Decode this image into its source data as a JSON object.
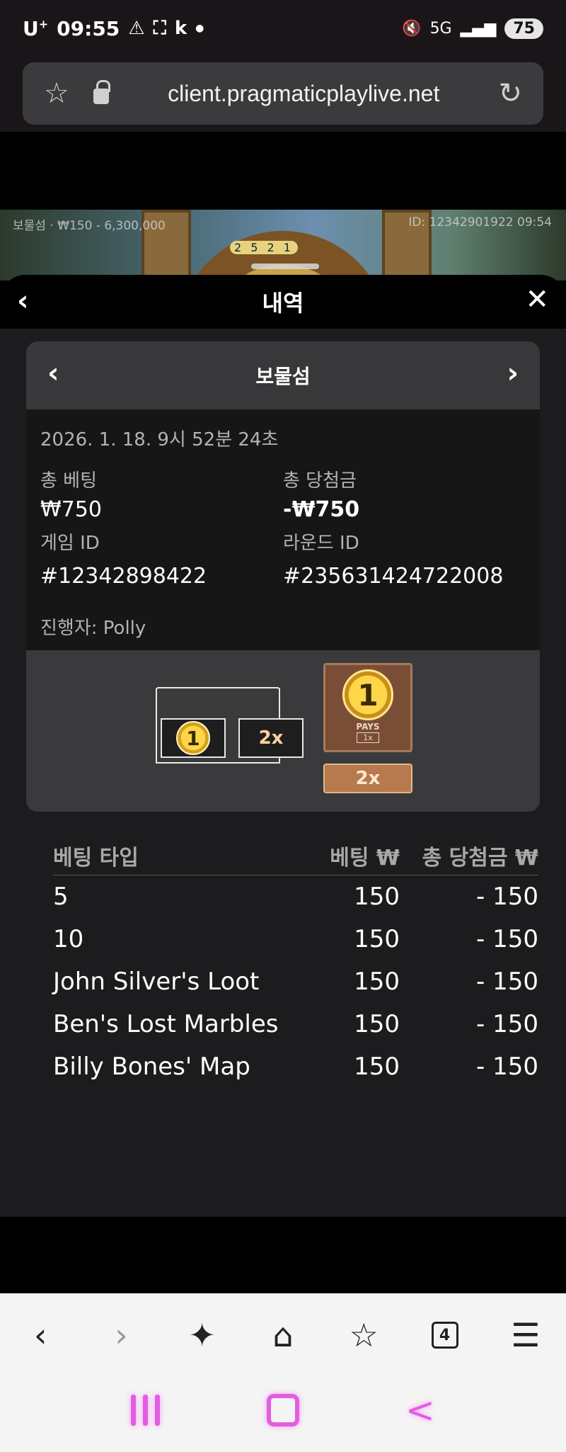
{
  "status_bar": {
    "carrier": "U",
    "carrier_sup": "+",
    "time": "09:55",
    "indicators": [
      "warning-icon",
      "screen-capture-icon",
      "k",
      "dot"
    ],
    "network": "5G",
    "battery": "75"
  },
  "browser": {
    "url": "client.pragmaticplaylive.net"
  },
  "game_strip": {
    "left_text": "보물섬 · ₩150 - 6,300,000",
    "right_text": "ID: 12342901922 09:54",
    "wheel_numbers": "2 5 2 1"
  },
  "sheet": {
    "title": "내역"
  },
  "card": {
    "game_title": "보물섬",
    "datetime": "2026. 1. 18. 9시 52분 24초",
    "total_bet_label": "총 베팅",
    "total_bet_value": "₩750",
    "total_win_label": "총 당첨금",
    "total_win_value": "-₩750",
    "game_id_label": "게임 ID",
    "game_id_value": "#12342898422",
    "round_id_label": "라운드 ID",
    "round_id_value": "#235631424722008",
    "dealer": "진행자: Polly",
    "result": {
      "chest_coin": "1",
      "chest_multiplier": "2x",
      "tile_coin": "1",
      "tile_pays": "PAYS",
      "tile_pays_mult": "1x",
      "tile_multiplier": "2x"
    }
  },
  "bets": {
    "headers": {
      "type": "베팅 타입",
      "bet": "베팅 ₩",
      "win": "총 당첨금 ₩"
    },
    "rows": [
      {
        "type": "5",
        "bet": "150",
        "win": "- 150"
      },
      {
        "type": "10",
        "bet": "150",
        "win": "- 150"
      },
      {
        "type": "John Silver's Loot",
        "bet": "150",
        "win": "- 150"
      },
      {
        "type": "Ben's Lost Marbles",
        "bet": "150",
        "win": "- 150"
      },
      {
        "type": "Billy Bones' Map",
        "bet": "150",
        "win": "- 150"
      }
    ]
  },
  "bottom_nav": {
    "tabs_count": "4"
  },
  "colors": {
    "sheet_bg": "#1c1c1e",
    "card_head_bg": "#38383a",
    "system_nav_accent": "#e35de0"
  }
}
